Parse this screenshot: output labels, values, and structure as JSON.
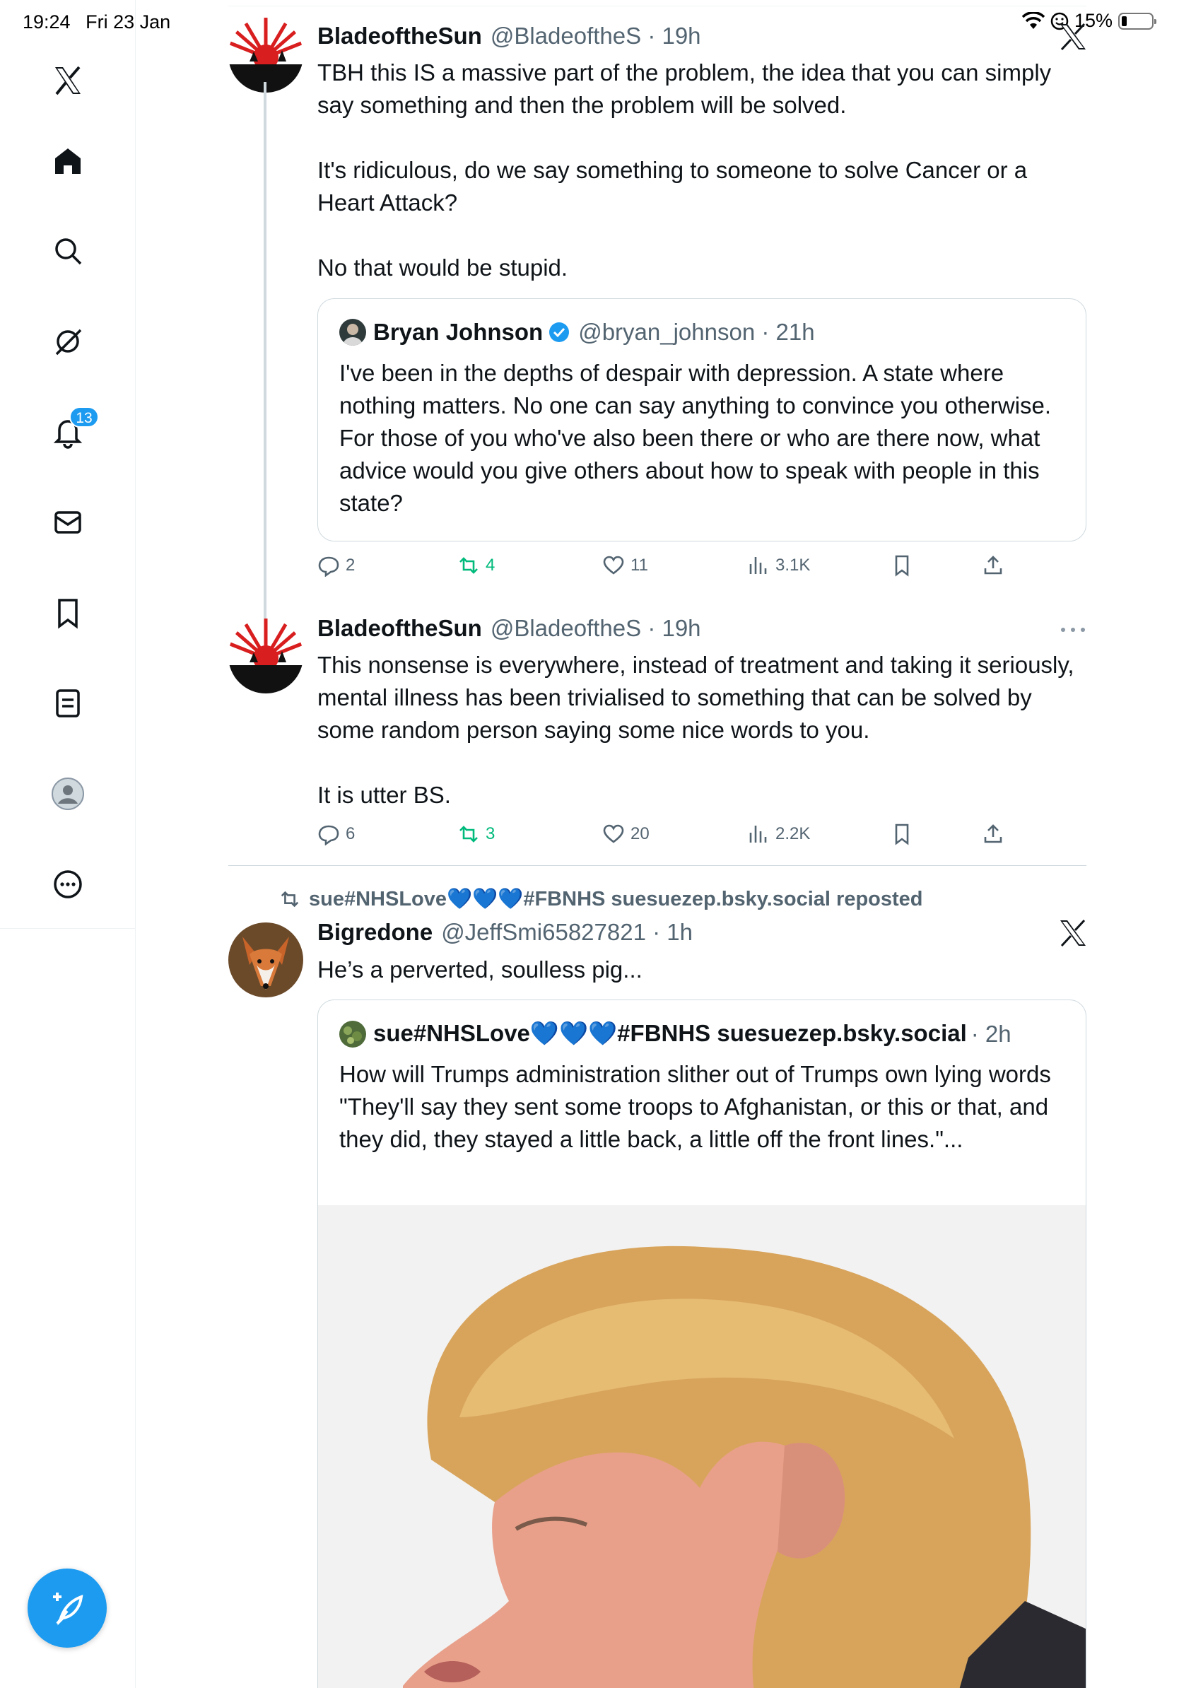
{
  "status_bar": {
    "time": "19:24",
    "date": "Fri 23 Jan",
    "battery": "15%"
  },
  "nav": {
    "items": [
      "x-logo",
      "home",
      "search",
      "grok",
      "notifications",
      "messages",
      "bookmarks",
      "lists",
      "profile",
      "more"
    ],
    "notifications_badge": "13"
  },
  "tweets": [
    {
      "name": "BladeoftheSun",
      "handle": "@BladeoftheS · 19h",
      "text": "TBH this IS a massive part of the problem, the idea that you can simply say something and then the problem will be solved.\n\nIt's ridiculous, do we say something to someone to solve Cancer or a Heart Attack?\n\nNo that would be stupid.",
      "quote": {
        "name": "Bryan Johnson",
        "handle": "@bryan_johnson · 21h",
        "text": "I've been in the depths of despair with depression. A state where nothing matters. No one can say anything to convince you otherwise. For those of you who've also been there or who are there now, what advice would you give others about how to speak with people in this state?"
      },
      "replies": "2",
      "retweets": "4",
      "likes": "11",
      "views": "3.1K"
    },
    {
      "name": "BladeoftheSun",
      "handle": "@BladeoftheS · 19h",
      "text": "This nonsense is everywhere, instead of treatment and taking it seriously, mental illness has been trivialised to something that can be solved by some random person saying some nice words to you.\n\nIt is utter BS.",
      "replies": "6",
      "retweets": "3",
      "likes": "20",
      "views": "2.2K"
    },
    {
      "reposted_by": "sue#NHSLove💙💙💙#FBNHS suesuezep.bsky.social reposted",
      "name": "Bigredone",
      "handle": "@JeffSmi65827821 · 1h",
      "text": "He’s a perverted, soulless pig...",
      "quote": {
        "name": "sue#NHSLove💙💙💙#FBNHS suesuezep.bsky.social",
        "handle": "· 2h",
        "text": "How will Trumps administration slither out of Trumps own lying words \"They'll say they sent some troops to Afghanistan, or this or that, and they did, they stayed a little back, a little off the front lines.\"..."
      }
    }
  ],
  "colors": {
    "accent": "#1d9bf0",
    "retweet": "#00ba7c",
    "secondary_text": "#536471",
    "border": "#cfd9de"
  }
}
